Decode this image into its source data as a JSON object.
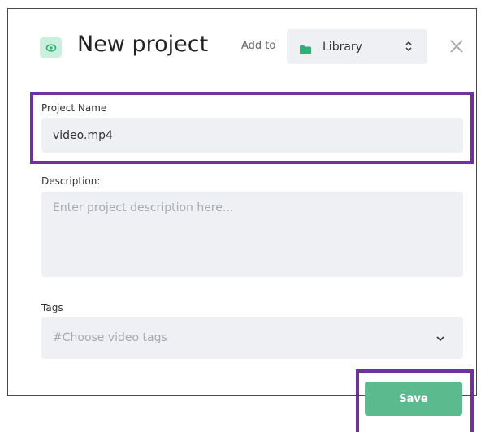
{
  "header": {
    "title": "New project",
    "add_to_label": "Add to",
    "library_select": {
      "value": "Library"
    },
    "project_icon": "eye-icon",
    "close_icon": "close-icon"
  },
  "form": {
    "project_name": {
      "label": "Project Name",
      "value": "video.mp4"
    },
    "description": {
      "label": "Description:",
      "placeholder": "Enter project description here...",
      "value": ""
    },
    "tags": {
      "label": "Tags",
      "placeholder": "#Choose video tags"
    },
    "save_label": "Save"
  },
  "colors": {
    "accent_green": "#5cba8f",
    "icon_bg": "#c8f0dd",
    "highlight": "#7030a0",
    "field_bg": "#eef0f3"
  }
}
